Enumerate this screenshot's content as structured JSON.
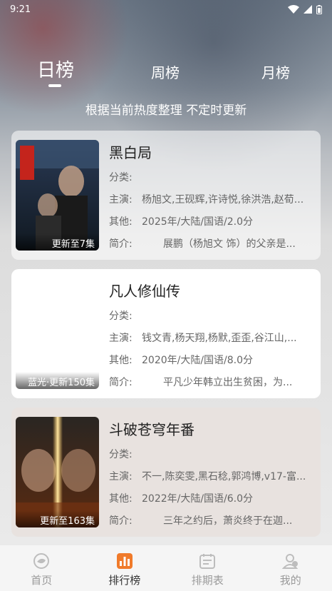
{
  "status_bar": {
    "time": "9:21"
  },
  "tabs": [
    {
      "label": "日榜",
      "active": true
    },
    {
      "label": "周榜",
      "active": false
    },
    {
      "label": "月榜",
      "active": false
    }
  ],
  "subtitle": "根据当前热度整理 不定时更新",
  "labels": {
    "category": "分类:",
    "cast": "主演:",
    "other": "其他:",
    "synopsis": "简介:"
  },
  "cards": [
    {
      "title": "黑白局",
      "badge": "更新至7集",
      "category": "",
      "cast": "杨旭文,王砚辉,许诗悦,徐洪浩,赵荀...",
      "other": "2025年/大陆/国语/2.0分",
      "synopsis": "展鹏（杨旭文 饰）的父亲是..."
    },
    {
      "title": "凡人修仙传",
      "badge": "蓝光·更新150集",
      "category": "",
      "cast": "钱文青,杨天翔,杨默,歪歪,谷江山,...",
      "other": "2020年/大陆/国语/8.0分",
      "synopsis": "平凡少年韩立出生贫困，为..."
    },
    {
      "title": "斗破苍穹年番",
      "badge": "更新至163集",
      "category": "",
      "cast": "不一,陈奕雯,黑石稔,郭鸿博,v17-富...",
      "other": "2022年/大陆/国语/6.0分",
      "synopsis": "三年之约后，萧炎终于在迦..."
    }
  ],
  "bottom_nav": [
    {
      "label": "首页",
      "icon": "home-icon",
      "active": false
    },
    {
      "label": "排行榜",
      "icon": "ranking-icon",
      "active": true
    },
    {
      "label": "排期表",
      "icon": "schedule-icon",
      "active": false
    },
    {
      "label": "我的",
      "icon": "profile-icon",
      "active": false
    }
  ],
  "colors": {
    "accent": "#f07a2a",
    "inactive": "#9a9a9a"
  }
}
